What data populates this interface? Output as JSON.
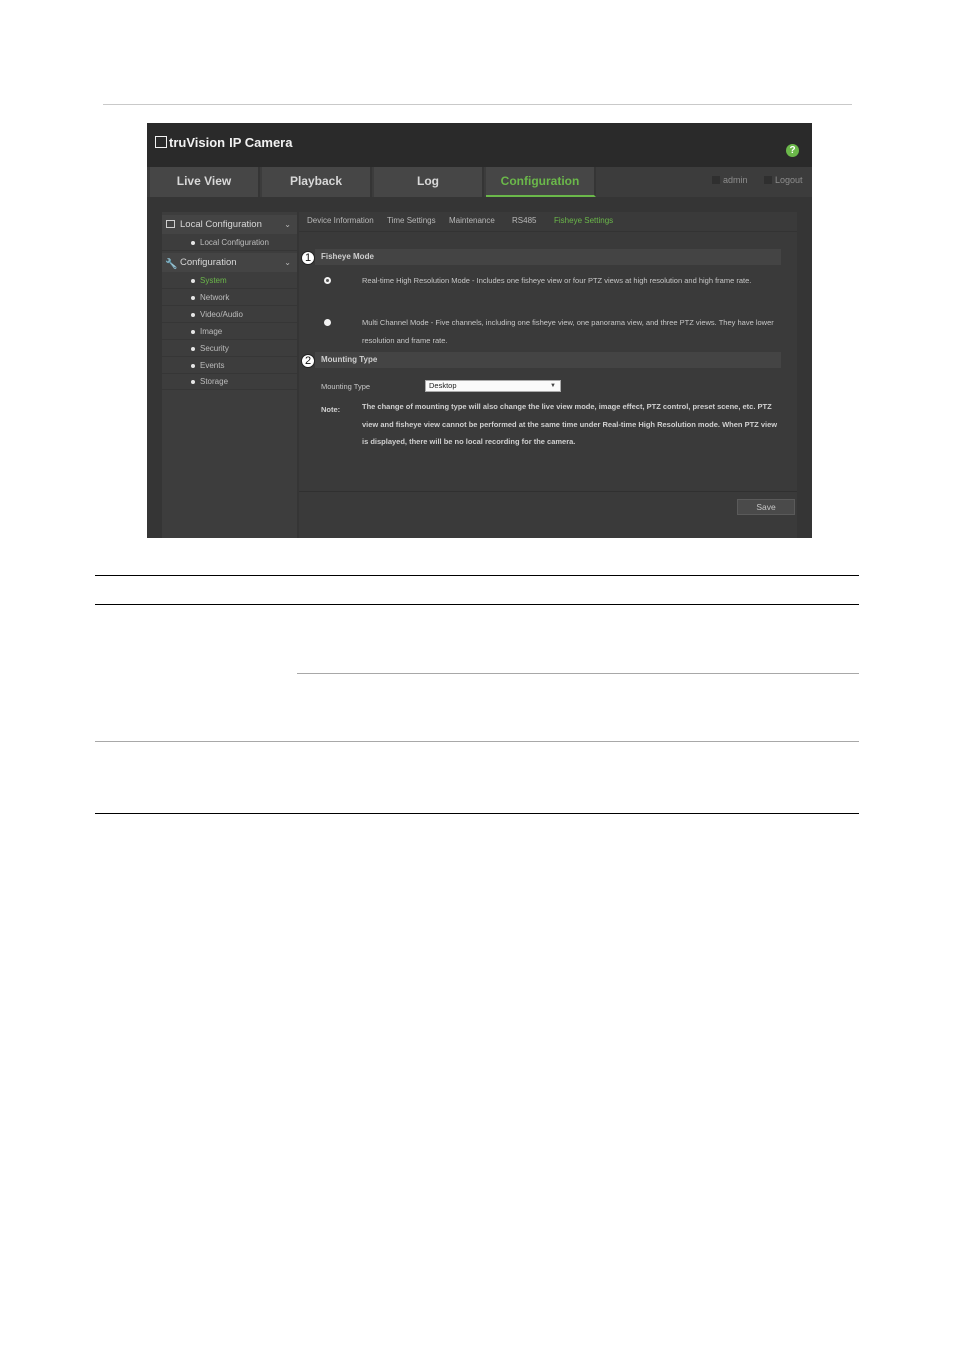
{
  "app": {
    "logo_brand": "truVision",
    "logo_suffix": "IP Camera",
    "help_glyph": "?"
  },
  "nav": {
    "tabs": [
      {
        "label": "Live View"
      },
      {
        "label": "Playback"
      },
      {
        "label": "Log"
      },
      {
        "label": "Configuration"
      }
    ],
    "active_tab": "Configuration",
    "user": "admin",
    "logout": "Logout"
  },
  "sidebar": {
    "local_config": "Local Configuration",
    "local_items": [
      "Local Configuration"
    ],
    "configuration": "Configuration",
    "config_items": [
      "System",
      "Network",
      "Video/Audio",
      "Image",
      "Security",
      "Events",
      "Storage"
    ],
    "active_item": "System",
    "chevron": "⌄"
  },
  "subtabs": [
    "Device Information",
    "Time Settings",
    "Maintenance",
    "RS485",
    "Fisheye Settings"
  ],
  "active_subtab": "Fisheye Settings",
  "fisheye": {
    "section_title": "Fisheye Mode",
    "option1": "Real-time High Resolution Mode - Includes one fisheye view or four PTZ views at high resolution and high frame rate.",
    "option2": "Multi Channel Mode - Five channels, including one fisheye view, one panorama view, and three PTZ views. They have lower resolution and frame rate."
  },
  "mounting": {
    "section_title": "Mounting Type",
    "label": "Mounting Type",
    "value": "Desktop",
    "note_label": "Note:",
    "note_text": "The change of mounting type will also change the live view mode, image effect, PTZ control, preset scene, etc. PTZ view and fisheye view cannot be performed at the same time under Real-time High Resolution mode. When PTZ view is displayed, there will be no local recording for the camera."
  },
  "save_label": "Save",
  "callouts": [
    "1",
    "2"
  ],
  "colors": {
    "accent": "#6bb84a",
    "header_bg": "#2a2a2a",
    "panel_bg": "#353535"
  }
}
